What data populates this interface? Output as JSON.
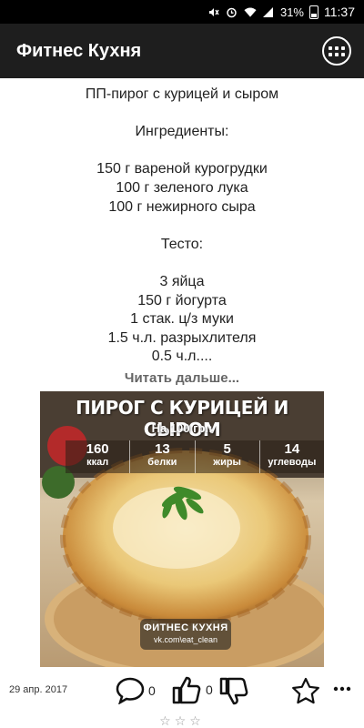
{
  "status_bar": {
    "battery_percent": "31%",
    "time": "11:37",
    "icons": [
      "mute-icon",
      "alarm-icon",
      "wifi-icon",
      "signal-icon",
      "battery-icon"
    ]
  },
  "app_bar": {
    "title": "Фитнес Кухня",
    "menu_icon": "grid-menu-icon"
  },
  "post": {
    "lines": [
      "ПП-пирог с курицей и сыром",
      "",
      "Ингредиенты:",
      "",
      "150 г вареной курогрудки",
      "100 г зеленого лука",
      "100 г нежирного сыра",
      "",
      "Тесто:",
      "",
      "3 яйца",
      "150 г йогурта",
      "1 стак. ц/з муки",
      "1.5 ч.л. разрыхлителя",
      "0.5 ч.л...."
    ],
    "read_more": "Читать дальше...",
    "image": {
      "title": "ПИРОГ С КУРИЦЕЙ И СЫРОМ",
      "subtitle": "На 100 гр.:",
      "nutrition": [
        {
          "value": "160",
          "label": "ккал"
        },
        {
          "value": "13",
          "label": "белки"
        },
        {
          "value": "5",
          "label": "жиры"
        },
        {
          "value": "14",
          "label": "углеводы"
        }
      ],
      "brand_name": "ФИТНЕС КУХНЯ",
      "brand_url": "vk.com\\eat_clean"
    },
    "date": "29 апр. 2017",
    "comments_count": "0",
    "likes_count": "0",
    "dislikes_count": "",
    "rating_stars": "☆☆☆"
  },
  "colors": {
    "app_bar_bg": "#1e1e1e",
    "status_bar_bg": "#000000",
    "read_more": "#666666"
  }
}
